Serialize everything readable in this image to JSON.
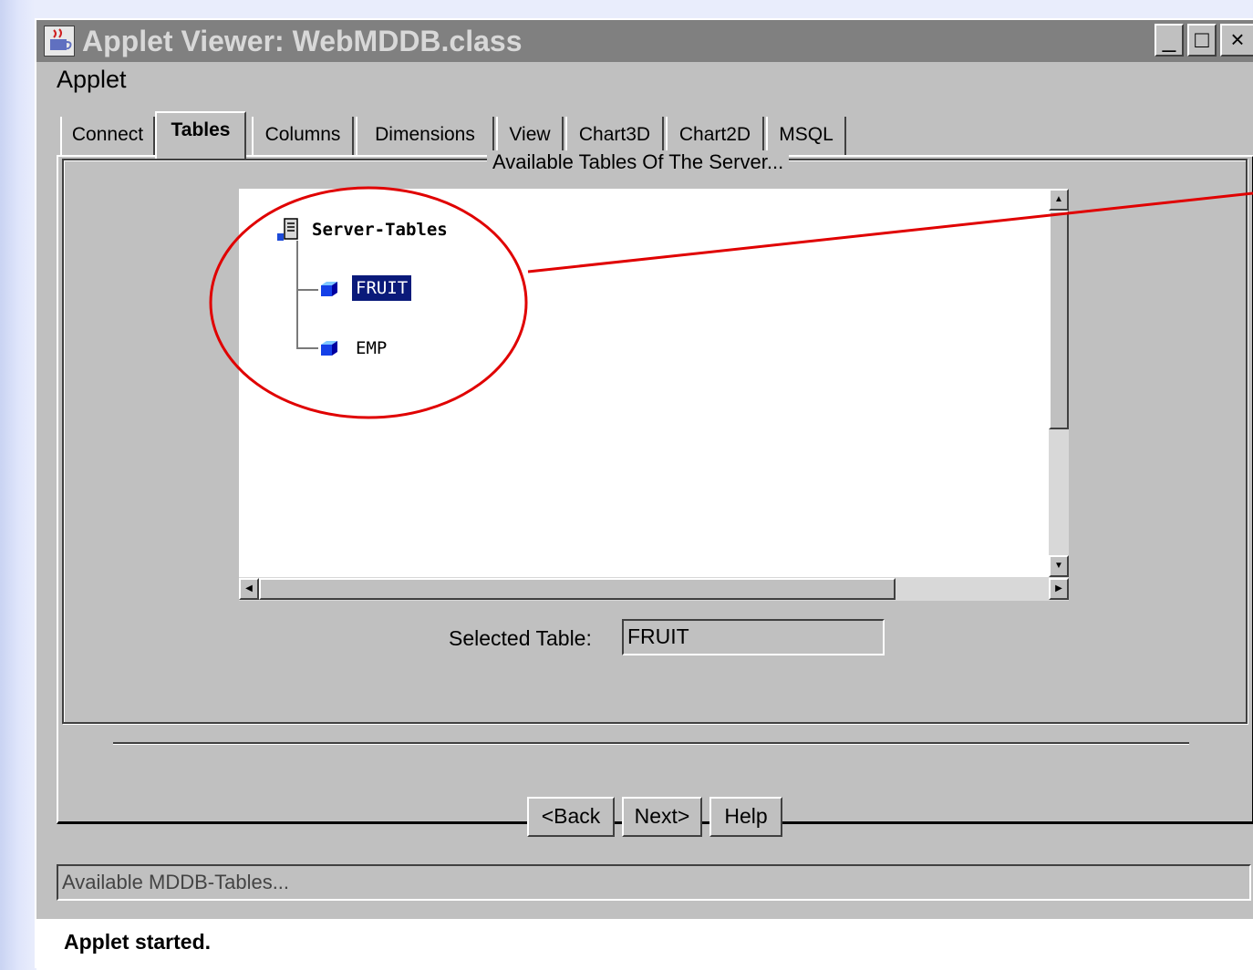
{
  "window": {
    "title": "Applet Viewer: WebMDDB.class",
    "controls": {
      "minimize": "_",
      "maximize": "□",
      "close": "×"
    }
  },
  "menu": {
    "applet": "Applet"
  },
  "tabs": [
    {
      "label": "Connect",
      "active": false
    },
    {
      "label": "Tables",
      "active": true
    },
    {
      "label": "Columns",
      "active": false
    },
    {
      "label": "Dimensions",
      "active": false
    },
    {
      "label": "View",
      "active": false
    },
    {
      "label": "Chart3D",
      "active": false
    },
    {
      "label": "Chart2D",
      "active": false
    },
    {
      "label": "MSQL",
      "active": false
    }
  ],
  "group": {
    "title": "Available Tables Of The Server..."
  },
  "tree": {
    "root": {
      "label": "Server-Tables",
      "icon": "server-icon"
    },
    "nodes": [
      {
        "label": "FRUIT",
        "icon": "table-cube-icon",
        "selected": true
      },
      {
        "label": "EMP",
        "icon": "table-cube-icon",
        "selected": false
      }
    ]
  },
  "scroll": {
    "up": "▲",
    "down": "▼",
    "left": "◀",
    "right": "▶"
  },
  "selected_table": {
    "label": "Selected Table:",
    "value": "FRUIT"
  },
  "buttons": {
    "back": "<Back",
    "next": "Next>",
    "help": "Help"
  },
  "status_field": "Available MDDB-Tables...",
  "statusbar": "Applet started.",
  "colors": {
    "selection": "#0a1a7a",
    "annotation": "#e00000",
    "titlebar": "#808080",
    "background": "#c0c0c0"
  }
}
